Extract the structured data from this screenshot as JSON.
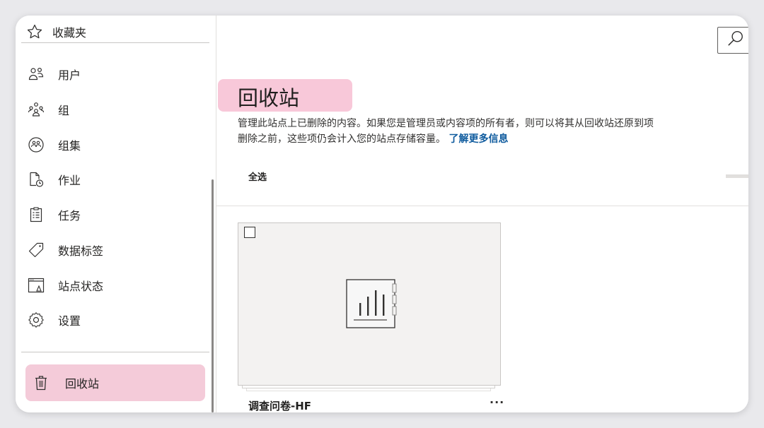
{
  "sidebar": {
    "favorites_label": "收藏夹",
    "items": [
      {
        "label": "用户",
        "icon": "users-icon"
      },
      {
        "label": "组",
        "icon": "group-icon"
      },
      {
        "label": "组集",
        "icon": "group-collection-icon"
      },
      {
        "label": "作业",
        "icon": "job-icon"
      },
      {
        "label": "任务",
        "icon": "task-icon"
      },
      {
        "label": "数据标签",
        "icon": "tag-icon"
      },
      {
        "label": "站点状态",
        "icon": "site-status-icon"
      },
      {
        "label": "设置",
        "icon": "gear-icon"
      }
    ],
    "recycle_bin_label": "回收站",
    "highlight_color": "#f4cbd9"
  },
  "main": {
    "title": "回收站",
    "description_line1": "管理此站点上已删除的内容。如果您是管理员或内容项的所有者，则可以将其从回收站还原到项",
    "description_line2": "删除之前，这些项仍会计入您的站点存储容量。",
    "learn_more": "了解更多信息",
    "select_all": "全选",
    "link_color": "#0f5b9e"
  },
  "cards": [
    {
      "title": "调查问卷-HF",
      "more": "···",
      "icon": "survey-form-icon"
    }
  ]
}
